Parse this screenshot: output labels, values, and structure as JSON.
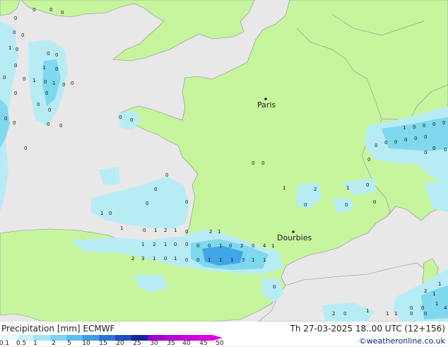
{
  "map": {
    "land_color": "#c6f59e",
    "sea_color": "#e8e8e8",
    "precip_light": "#b8ecf4",
    "precip_mid": "#7fd8ee",
    "precip_heavy": "#3fa6e8",
    "cities": [
      {
        "name": "Paris"
      },
      {
        "name": "Dourbies"
      }
    ]
  },
  "legend": {
    "title": "Precipitation [mm]  ECMWF",
    "ticks": [
      "0.1",
      "0.5",
      "1",
      "2",
      "5",
      "10",
      "15",
      "20",
      "25",
      "30",
      "35",
      "40",
      "45",
      "50"
    ],
    "colors": [
      "#e8f8fc",
      "#c8f0fa",
      "#a4e4f6",
      "#7ed4f2",
      "#58c0ee",
      "#3a9ee6",
      "#2a74d8",
      "#1e4cc2",
      "#14289e",
      "#9a00c8",
      "#b800d4",
      "#cc00d8",
      "#dc00dc"
    ]
  },
  "footer": {
    "datetime": "Th 27-03-2025 18..00 UTC (12+156)",
    "credit": "©weatheronline.co.uk"
  },
  "values": [
    "0",
    "0",
    "0",
    "0",
    "0",
    "0",
    "1",
    "0",
    "0",
    "0",
    "1",
    "0",
    "0",
    "0",
    "0",
    "1",
    "0",
    "1",
    "0",
    "0",
    "0",
    "0",
    "0",
    "0",
    "0",
    "0",
    "0",
    "0",
    "0",
    "0",
    "0",
    "1",
    "0",
    "0",
    "0",
    "0",
    "0",
    "0",
    "0",
    "0",
    "0",
    "0",
    "0",
    "0",
    "0",
    "0",
    "0",
    "0",
    "0",
    "1",
    "0",
    "0",
    "1",
    "0",
    "1",
    "2",
    "1",
    "0",
    "2",
    "1",
    "1",
    "2",
    "1",
    "0",
    "0",
    "0",
    "0",
    "1",
    "0",
    "2",
    "0",
    "4",
    "1",
    "2",
    "3",
    "1",
    "0",
    "1",
    "0",
    "0",
    "1",
    "1",
    "1",
    "3",
    "1",
    "1",
    "0",
    "1",
    "2",
    "1",
    "0",
    "0",
    "0",
    "0",
    "0",
    "0",
    "1",
    "1",
    "0",
    "0",
    "2",
    "0",
    "1",
    "4",
    "1",
    "2",
    "1",
    "1",
    "0",
    "0"
  ]
}
